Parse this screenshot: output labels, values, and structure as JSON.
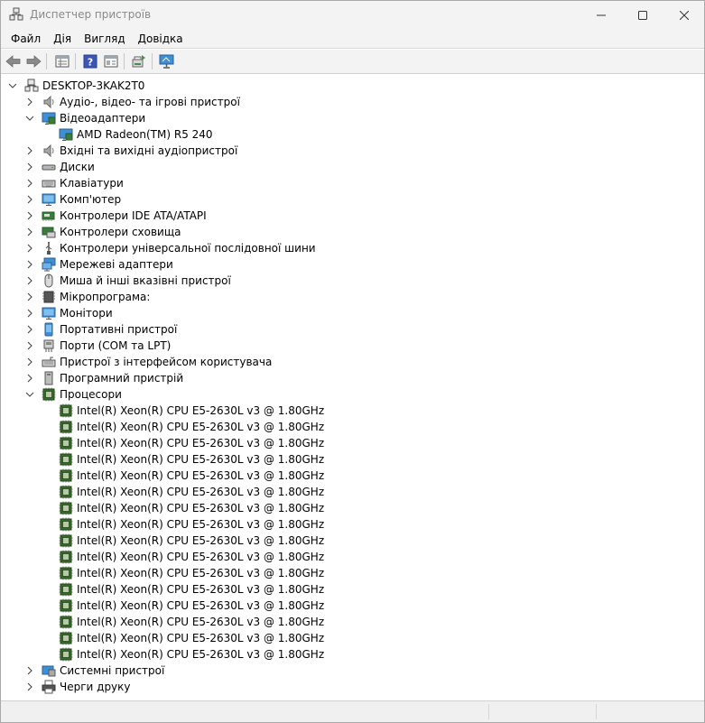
{
  "window": {
    "title": "Диспетчер пристроїв"
  },
  "menu": [
    {
      "label": "Файл"
    },
    {
      "label": "Дія"
    },
    {
      "label": "Вигляд"
    },
    {
      "label": "Довідка"
    }
  ],
  "toolbar": {
    "icons": [
      "back-arrow-icon",
      "forward-arrow-icon",
      "properties-icon",
      "help-icon",
      "view-icon",
      "update-driver-icon",
      "scan-hardware-icon"
    ]
  },
  "tree": {
    "root": {
      "label": "DESKTOP-3KAK2T0",
      "icon": "computer-root-icon",
      "expanded": true
    },
    "nodes": [
      {
        "label": "Аудіо-, відео- та ігрові пристрої",
        "icon": "speaker-icon",
        "expanded": false,
        "children": []
      },
      {
        "label": "Відеоадаптери",
        "icon": "display-adapter-icon",
        "expanded": true,
        "children": [
          {
            "label": "AMD Radeon(TM) R5 240",
            "icon": "display-adapter-icon"
          }
        ]
      },
      {
        "label": "Вхідні та вихідні аудіопристрої",
        "icon": "speaker-icon",
        "expanded": false,
        "children": []
      },
      {
        "label": "Диски",
        "icon": "disk-drive-icon",
        "expanded": false,
        "children": []
      },
      {
        "label": "Клавіатури",
        "icon": "keyboard-icon",
        "expanded": false,
        "children": []
      },
      {
        "label": "Комп'ютер",
        "icon": "monitor-icon",
        "expanded": false,
        "children": []
      },
      {
        "label": "Контролери IDE ATA/ATAPI",
        "icon": "ide-controller-icon",
        "expanded": false,
        "children": []
      },
      {
        "label": "Контролери сховища",
        "icon": "storage-controller-icon",
        "expanded": false,
        "children": []
      },
      {
        "label": "Контролери універсальної послідовної шини",
        "icon": "usb-icon",
        "expanded": false,
        "children": []
      },
      {
        "label": "Мережеві адаптери",
        "icon": "network-adapter-icon",
        "expanded": false,
        "children": []
      },
      {
        "label": "Миша й інші вказівні пристрої",
        "icon": "mouse-icon",
        "expanded": false,
        "children": []
      },
      {
        "label": "Мікропрограма:",
        "icon": "firmware-icon",
        "expanded": false,
        "children": []
      },
      {
        "label": "Монітори",
        "icon": "monitor-icon",
        "expanded": false,
        "children": []
      },
      {
        "label": "Портативні пристрої",
        "icon": "portable-device-icon",
        "expanded": false,
        "children": []
      },
      {
        "label": "Порти (COM та LPT)",
        "icon": "port-icon",
        "expanded": false,
        "children": []
      },
      {
        "label": "Пристрої з інтерфейсом користувача",
        "icon": "hid-icon",
        "expanded": false,
        "children": []
      },
      {
        "label": "Програмний пристрій",
        "icon": "software-device-icon",
        "expanded": false,
        "children": []
      },
      {
        "label": "Процесори",
        "icon": "processor-icon",
        "expanded": true,
        "children": [
          {
            "label": "Intel(R) Xeon(R) CPU E5-2630L v3 @ 1.80GHz",
            "icon": "processor-icon"
          },
          {
            "label": "Intel(R) Xeon(R) CPU E5-2630L v3 @ 1.80GHz",
            "icon": "processor-icon"
          },
          {
            "label": "Intel(R) Xeon(R) CPU E5-2630L v3 @ 1.80GHz",
            "icon": "processor-icon"
          },
          {
            "label": "Intel(R) Xeon(R) CPU E5-2630L v3 @ 1.80GHz",
            "icon": "processor-icon"
          },
          {
            "label": "Intel(R) Xeon(R) CPU E5-2630L v3 @ 1.80GHz",
            "icon": "processor-icon"
          },
          {
            "label": "Intel(R) Xeon(R) CPU E5-2630L v3 @ 1.80GHz",
            "icon": "processor-icon"
          },
          {
            "label": "Intel(R) Xeon(R) CPU E5-2630L v3 @ 1.80GHz",
            "icon": "processor-icon"
          },
          {
            "label": "Intel(R) Xeon(R) CPU E5-2630L v3 @ 1.80GHz",
            "icon": "processor-icon"
          },
          {
            "label": "Intel(R) Xeon(R) CPU E5-2630L v3 @ 1.80GHz",
            "icon": "processor-icon"
          },
          {
            "label": "Intel(R) Xeon(R) CPU E5-2630L v3 @ 1.80GHz",
            "icon": "processor-icon"
          },
          {
            "label": "Intel(R) Xeon(R) CPU E5-2630L v3 @ 1.80GHz",
            "icon": "processor-icon"
          },
          {
            "label": "Intel(R) Xeon(R) CPU E5-2630L v3 @ 1.80GHz",
            "icon": "processor-icon"
          },
          {
            "label": "Intel(R) Xeon(R) CPU E5-2630L v3 @ 1.80GHz",
            "icon": "processor-icon"
          },
          {
            "label": "Intel(R) Xeon(R) CPU E5-2630L v3 @ 1.80GHz",
            "icon": "processor-icon"
          },
          {
            "label": "Intel(R) Xeon(R) CPU E5-2630L v3 @ 1.80GHz",
            "icon": "processor-icon"
          },
          {
            "label": "Intel(R) Xeon(R) CPU E5-2630L v3 @ 1.80GHz",
            "icon": "processor-icon"
          }
        ]
      },
      {
        "label": "Системні пристрої",
        "icon": "system-device-icon",
        "expanded": false,
        "children": []
      },
      {
        "label": "Черги друку",
        "icon": "printer-icon",
        "expanded": false,
        "children": []
      }
    ]
  },
  "colors": {
    "chrome_bg": "#f3f3f3",
    "title_text": "#8a8a8a",
    "tree_bg": "#ffffff",
    "cpu_green": "#3a6b2a"
  }
}
